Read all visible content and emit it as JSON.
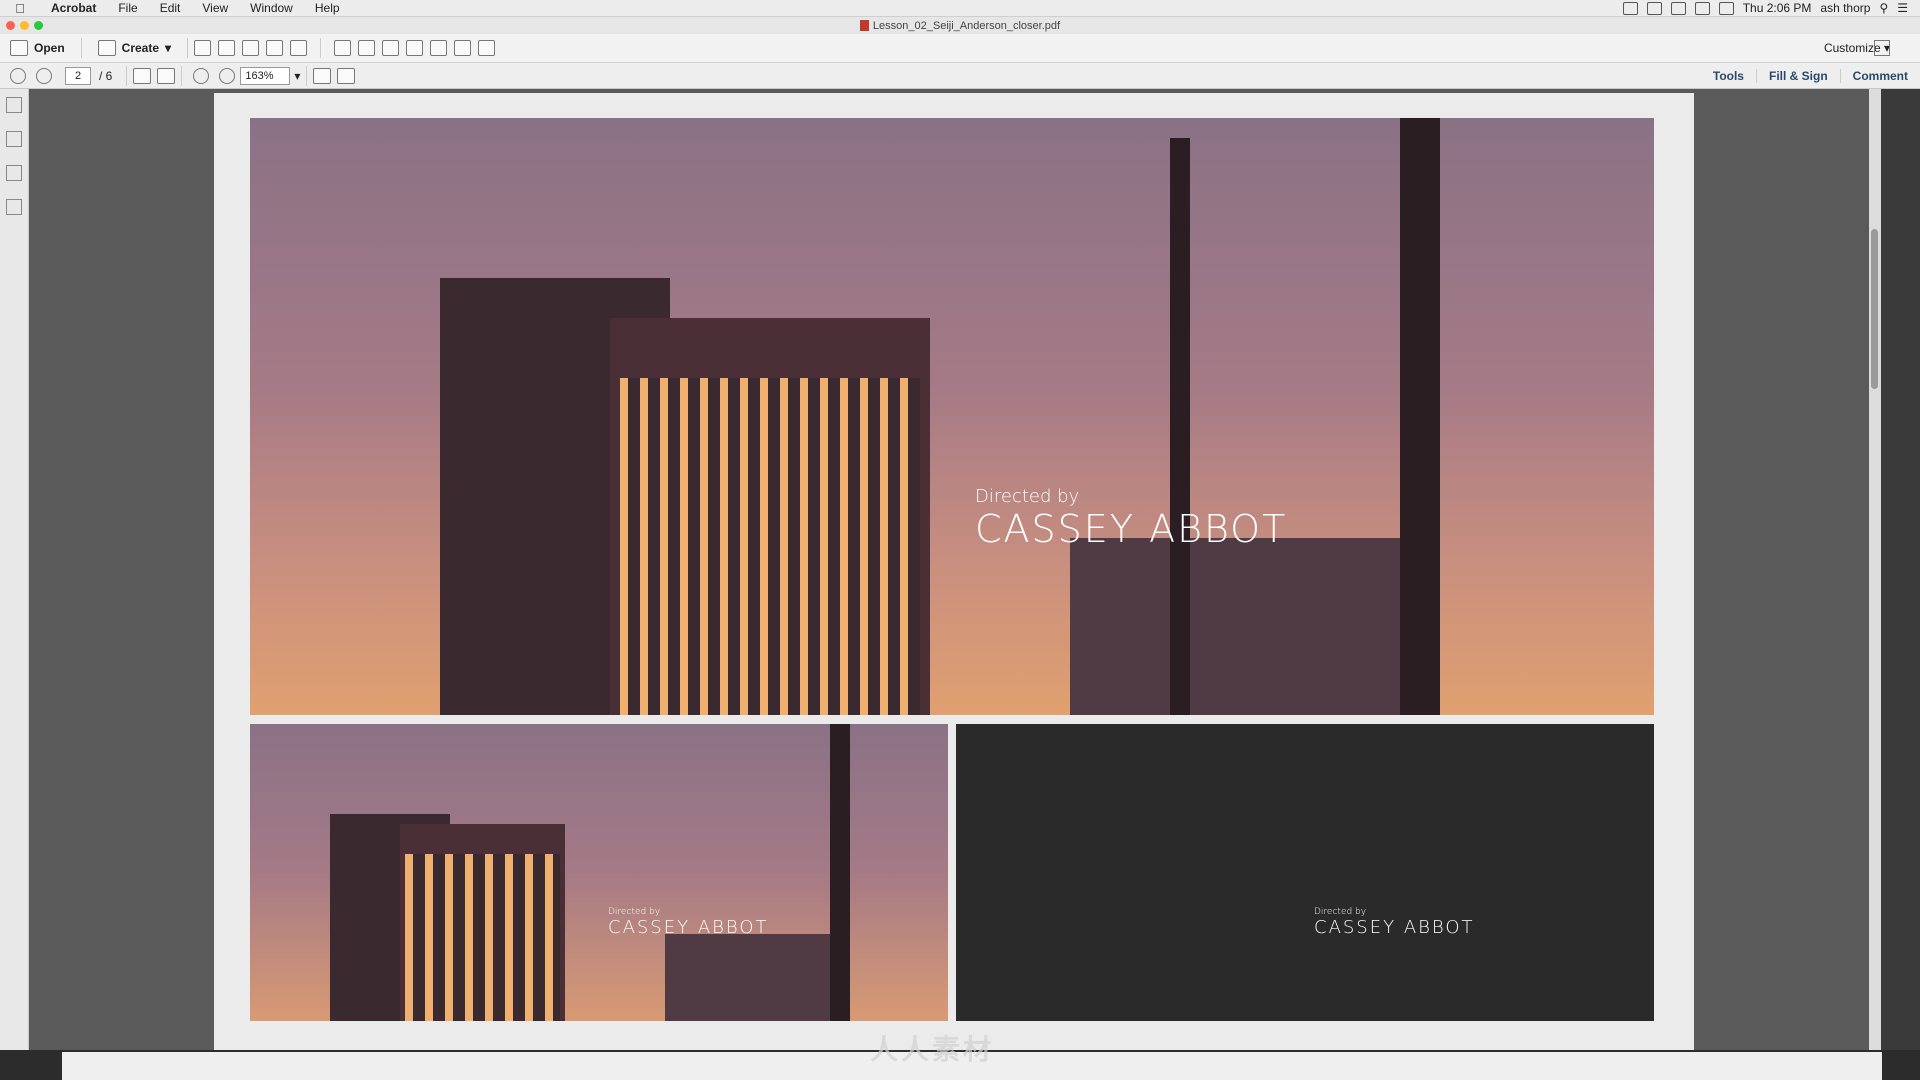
{
  "menubar": {
    "app_name": "Acrobat",
    "items": [
      "File",
      "Edit",
      "View",
      "Window",
      "Help"
    ],
    "clock": "Thu 2:06 PM",
    "user": "ash thorp"
  },
  "window": {
    "title": "Lesson_02_Seiji_Anderson_closer.pdf"
  },
  "toolbar": {
    "open_label": "Open",
    "create_label": "Create",
    "customize_label": "Customize"
  },
  "nav": {
    "current_page": "2",
    "total_pages": "/ 6",
    "zoom": "163%"
  },
  "right_panel": {
    "tools_label": "Tools",
    "fill_sign_label": "Fill & Sign",
    "comment_label": "Comment"
  },
  "frames": {
    "directed_by": "Directed by",
    "director": "Cassey Abbot"
  },
  "watermark": "人人素材"
}
